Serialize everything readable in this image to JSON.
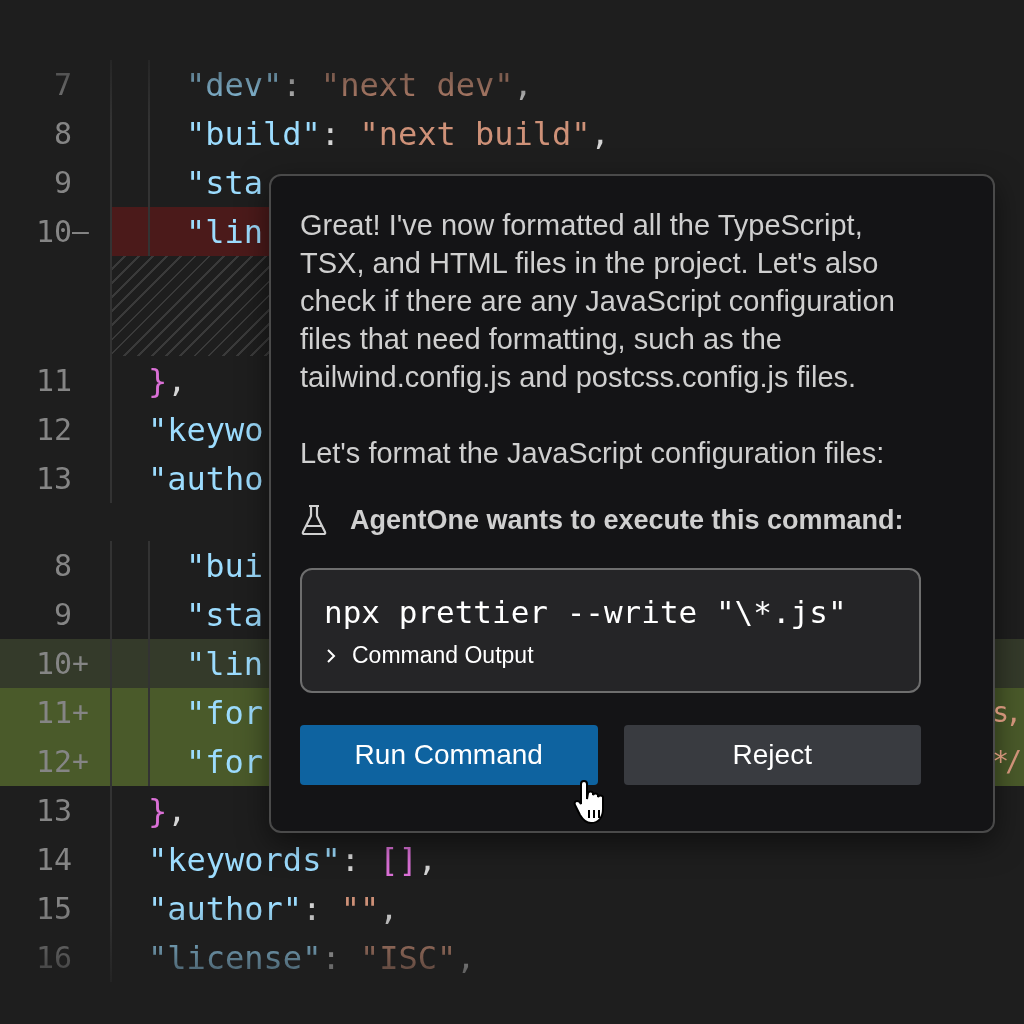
{
  "editor": {
    "hunks": [
      {
        "rows": [
          {
            "children": [
              {
                "num": "7",
                "kind": "context",
                "tokens": [
                  {
                    "kind": "key",
                    "text": "\"dev\""
                  },
                  {
                    "kind": "punct",
                    "text": ": "
                  },
                  {
                    "kind": "str",
                    "text": "\"next dev\""
                  },
                  {
                    "kind": "punct",
                    "text": ","
                  }
                ]
              },
              {
                "num": "8",
                "kind": "context",
                "tokens": [
                  {
                    "kind": "key",
                    "text": "\"build\""
                  },
                  {
                    "kind": "punct",
                    "text": ": "
                  },
                  {
                    "kind": "str",
                    "text": "\"next build\""
                  },
                  {
                    "kind": "punct",
                    "text": ","
                  }
                ]
              },
              {
                "num": "9",
                "kind": "context",
                "tokens": [
                  {
                    "kind": "key",
                    "text": "\"sta"
                  }
                ]
              },
              {
                "num": "10",
                "marker": "—",
                "kind": "removed",
                "tokens": [
                  {
                    "kind": "key",
                    "text": "\"lin"
                  }
                ]
              }
            ]
          },
          {
            "kind": "filler"
          },
          {
            "num": "11",
            "kind": "context",
            "tokens": [
              {
                "kind": "brace",
                "text": "}"
              },
              {
                "kind": "punct",
                "text": ","
              }
            ]
          },
          {
            "num": "12",
            "kind": "context",
            "tokens": [
              {
                "kind": "key",
                "text": "\"keywo"
              }
            ]
          },
          {
            "num": "13",
            "kind": "context",
            "tokens": [
              {
                "kind": "key",
                "text": "\"autho"
              }
            ]
          }
        ]
      },
      {
        "rows": [
          {
            "children": [
              {
                "num": "8",
                "kind": "context",
                "tokens": [
                  {
                    "kind": "key",
                    "text": "\"bui"
                  }
                ]
              },
              {
                "num": "9",
                "kind": "context",
                "tokens": [
                  {
                    "kind": "key",
                    "text": "\"sta"
                  }
                ]
              },
              {
                "num": "10",
                "marker": "+",
                "kind": "added-faint",
                "tokens": [
                  {
                    "kind": "key",
                    "text": "\"lin"
                  }
                ]
              },
              {
                "num": "11",
                "marker": "+",
                "kind": "added",
                "tokens": [
                  {
                    "kind": "key",
                    "text": "\"for"
                  }
                ],
                "tail": "s,"
              },
              {
                "num": "12",
                "marker": "+",
                "kind": "added",
                "tokens": [
                  {
                    "kind": "key",
                    "text": "\"for"
                  }
                ],
                "tail": "*/"
              }
            ]
          },
          {
            "num": "13",
            "kind": "context",
            "tokens": [
              {
                "kind": "brace",
                "text": "}"
              },
              {
                "kind": "punct",
                "text": ","
              }
            ]
          },
          {
            "num": "14",
            "kind": "context",
            "tokens": [
              {
                "kind": "key",
                "text": "\"keywords\""
              },
              {
                "kind": "punct",
                "text": ": "
              },
              {
                "kind": "brace",
                "text": "[]"
              },
              {
                "kind": "punct",
                "text": ","
              }
            ]
          },
          {
            "num": "15",
            "kind": "context",
            "tokens": [
              {
                "kind": "key",
                "text": "\"author\""
              },
              {
                "kind": "punct",
                "text": ": "
              },
              {
                "kind": "str",
                "text": "\"\""
              },
              {
                "kind": "punct",
                "text": ","
              }
            ]
          },
          {
            "num": "16",
            "kind": "context",
            "tokens": [
              {
                "kind": "key",
                "text": "\"license\""
              },
              {
                "kind": "punct",
                "text": ": "
              },
              {
                "kind": "str",
                "text": "\"ISC\""
              },
              {
                "kind": "punct",
                "text": ","
              }
            ]
          }
        ]
      }
    ]
  },
  "dialog": {
    "paragraphs": [
      "Great! I've now formatted all the TypeScript, TSX, and HTML files in the project. Let's also check if there are any JavaScript configuration files that need formatting, such as the tailwind.config.js and postcss.config.js files.",
      "Let's format the JavaScript configuration files:"
    ],
    "heading": "AgentOne wants to execute this command:",
    "command": "npx prettier --write \"\\*.js\"",
    "output_toggle": {
      "label": "Command Output",
      "expanded": false
    },
    "buttons": [
      {
        "label": "Run Command",
        "kind": "primary"
      },
      {
        "label": "Reject",
        "kind": "secondary"
      }
    ]
  }
}
